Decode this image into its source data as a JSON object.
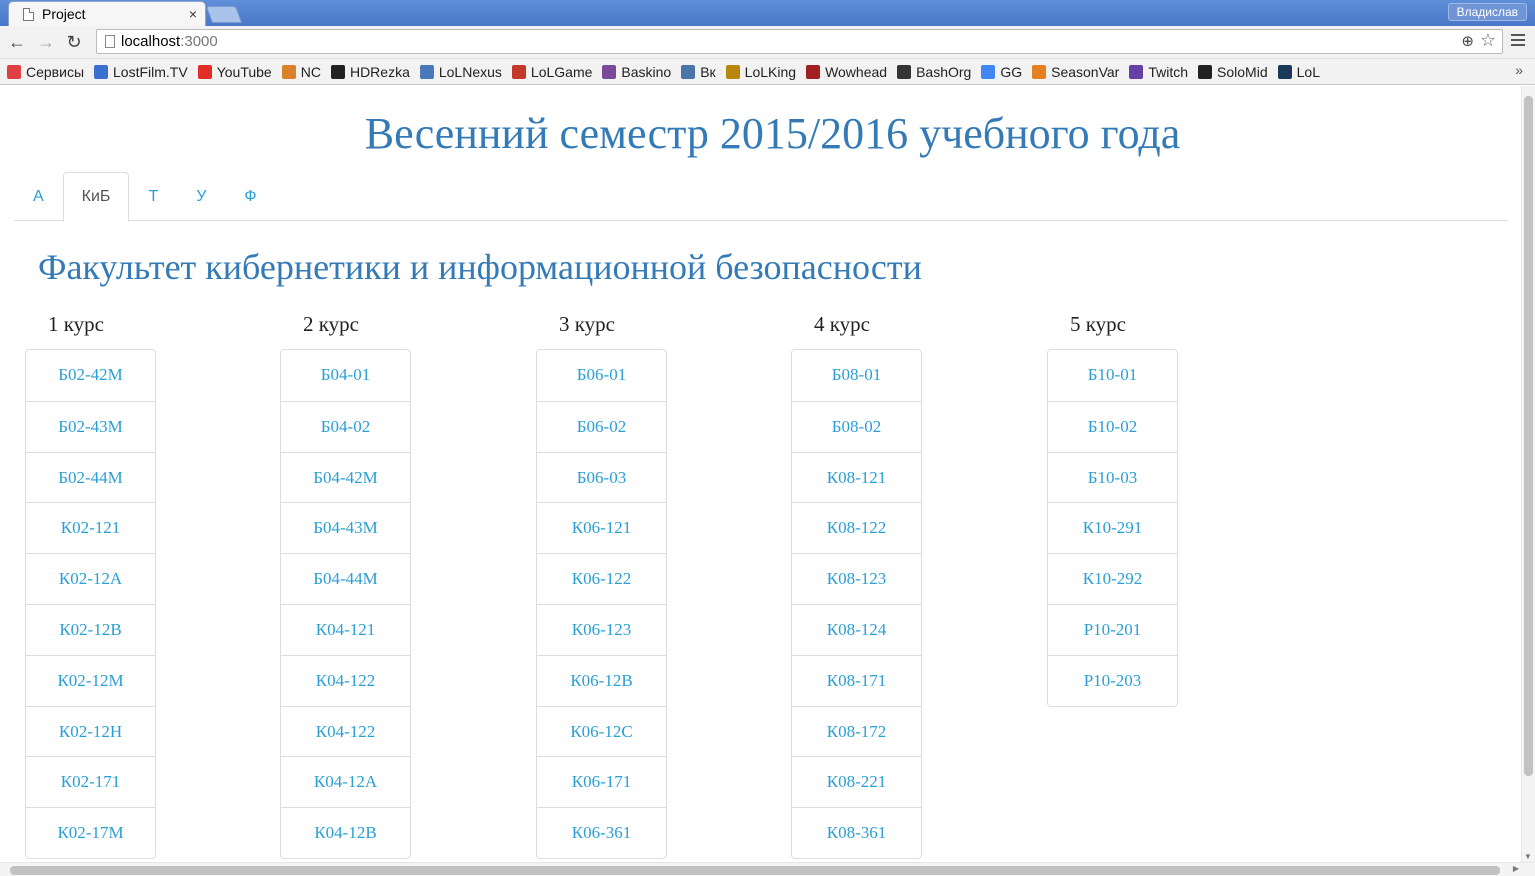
{
  "browser": {
    "tab_title": "Project",
    "tab_close": "×",
    "profile_name": "Владислав",
    "url_host": "localhost",
    "url_port": ":3000",
    "bookmarks_more": "»",
    "bookmarks": [
      {
        "label": "Сервисы",
        "icon": "apps-grid-icon",
        "color": "#e04040"
      },
      {
        "label": "LostFilm.TV",
        "icon": "lostfilm-icon",
        "color": "#3b6fd0"
      },
      {
        "label": "YouTube",
        "icon": "youtube-icon",
        "color": "#e52d27"
      },
      {
        "label": "NC",
        "icon": "nc-icon",
        "color": "#d9822b"
      },
      {
        "label": "HDRezka",
        "icon": "hdrezka-icon",
        "color": "#222222"
      },
      {
        "label": "LoLNexus",
        "icon": "lolnexus-icon",
        "color": "#4a78b8"
      },
      {
        "label": "LoLGame",
        "icon": "lolgame-icon",
        "color": "#c0392b"
      },
      {
        "label": "Baskino",
        "icon": "baskino-icon",
        "color": "#7a4a9a"
      },
      {
        "label": "Вк",
        "icon": "vk-icon",
        "color": "#4a76a8"
      },
      {
        "label": "LoLKing",
        "icon": "lolking-icon",
        "color": "#b8860b"
      },
      {
        "label": "Wowhead",
        "icon": "wowhead-icon",
        "color": "#a02020"
      },
      {
        "label": "BashOrg",
        "icon": "bashorg-icon",
        "color": "#333333"
      },
      {
        "label": "GG",
        "icon": "google-icon",
        "color": "#4285f4"
      },
      {
        "label": "SeasonVar",
        "icon": "seasonvar-icon",
        "color": "#e67e22"
      },
      {
        "label": "Twitch",
        "icon": "twitch-icon",
        "color": "#6441a5"
      },
      {
        "label": "SoloMid",
        "icon": "solomid-icon",
        "color": "#222222"
      },
      {
        "label": "LoL",
        "icon": "lol-icon",
        "color": "#1a3a5a"
      }
    ]
  },
  "page": {
    "title": "Весенний семестр 2015/2016 учебного года",
    "tabs": [
      "А",
      "КиБ",
      "Т",
      "У",
      "Ф"
    ],
    "active_tab": "КиБ",
    "faculty_title": "Факультет кибернетики и информационной безопасности",
    "courses": [
      {
        "label": "1 курс",
        "groups": [
          "Б02-42М",
          "Б02-43М",
          "Б02-44М",
          "К02-121",
          "К02-12А",
          "К02-12В",
          "К02-12М",
          "К02-12Н",
          "К02-171",
          "К02-17М"
        ]
      },
      {
        "label": "2 курс",
        "groups": [
          "Б04-01",
          "Б04-02",
          "Б04-42М",
          "Б04-43М",
          "Б04-44М",
          "К04-121",
          "К04-122",
          "К04-122",
          "К04-12А",
          "К04-12В"
        ]
      },
      {
        "label": "3 курс",
        "groups": [
          "Б06-01",
          "Б06-02",
          "Б06-03",
          "К06-121",
          "К06-122",
          "К06-123",
          "К06-12В",
          "К06-12С",
          "К06-171",
          "К06-361"
        ]
      },
      {
        "label": "4 курс",
        "groups": [
          "Б08-01",
          "Б08-02",
          "К08-121",
          "К08-122",
          "К08-123",
          "К08-124",
          "К08-171",
          "К08-172",
          "К08-221",
          "К08-361"
        ]
      },
      {
        "label": "5 курс",
        "groups": [
          "Б10-01",
          "Б10-02",
          "Б10-03",
          "К10-291",
          "К10-292",
          "Р10-201",
          "Р10-203"
        ]
      }
    ]
  },
  "colors": {
    "link": "#2a9fd6",
    "heading": "#337ab7"
  }
}
